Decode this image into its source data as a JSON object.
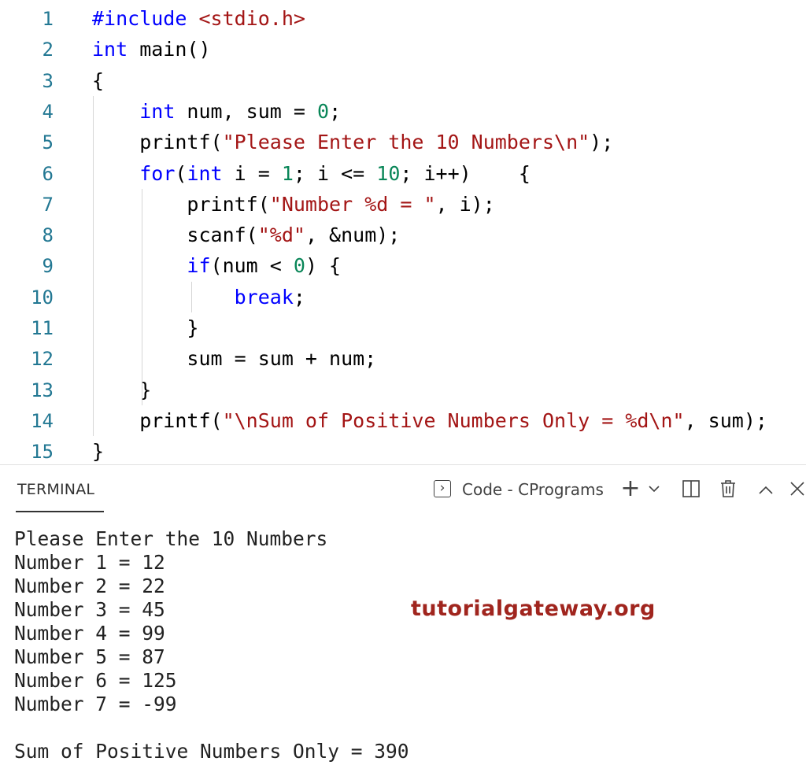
{
  "editor": {
    "lines": [
      {
        "n": "1",
        "t": [
          [
            "pp",
            "#include "
          ],
          [
            "inc",
            "<stdio.h>"
          ]
        ]
      },
      {
        "n": "2",
        "t": [
          [
            "kw",
            "int"
          ],
          [
            "",
            ""
          ],
          [
            "",
            " main()"
          ]
        ]
      },
      {
        "n": "3",
        "t": [
          [
            "",
            "{"
          ]
        ]
      },
      {
        "n": "4",
        "t": [
          [
            "",
            "    "
          ],
          [
            "kw",
            "int"
          ],
          [
            "",
            " num, sum = "
          ],
          [
            "num",
            "0"
          ],
          [
            "",
            ";"
          ]
        ]
      },
      {
        "n": "5",
        "t": [
          [
            "",
            "    printf("
          ],
          [
            "str",
            "\"Please Enter the 10 Numbers\\n\""
          ],
          [
            "",
            ");"
          ]
        ]
      },
      {
        "n": "6",
        "t": [
          [
            "",
            "    "
          ],
          [
            "kw",
            "for"
          ],
          [
            "",
            "("
          ],
          [
            "kw",
            "int"
          ],
          [
            "",
            " i = "
          ],
          [
            "num",
            "1"
          ],
          [
            "",
            "; i <= "
          ],
          [
            "num",
            "10"
          ],
          [
            "",
            "; i++)    {"
          ]
        ]
      },
      {
        "n": "7",
        "t": [
          [
            "",
            "        printf("
          ],
          [
            "str",
            "\"Number %d = \""
          ],
          [
            "",
            ", i);"
          ]
        ]
      },
      {
        "n": "8",
        "t": [
          [
            "",
            "        scanf("
          ],
          [
            "str",
            "\"%d\""
          ],
          [
            "",
            ", &num);"
          ]
        ]
      },
      {
        "n": "9",
        "t": [
          [
            "",
            "        "
          ],
          [
            "kw",
            "if"
          ],
          [
            "",
            "(num < "
          ],
          [
            "num",
            "0"
          ],
          [
            "",
            ") {"
          ]
        ]
      },
      {
        "n": "10",
        "t": [
          [
            "",
            "            "
          ],
          [
            "kw",
            "break"
          ],
          [
            "",
            ";"
          ]
        ]
      },
      {
        "n": "11",
        "t": [
          [
            "",
            "        }"
          ]
        ]
      },
      {
        "n": "12",
        "t": [
          [
            "",
            "        sum = sum + num;"
          ]
        ]
      },
      {
        "n": "13",
        "t": [
          [
            "",
            "    }"
          ]
        ]
      },
      {
        "n": "14",
        "t": [
          [
            "",
            "    printf("
          ],
          [
            "str",
            "\"\\nSum of Positive Numbers Only = %d\\n\""
          ],
          [
            "",
            ", sum);"
          ]
        ]
      },
      {
        "n": "15",
        "t": [
          [
            "",
            "}"
          ]
        ]
      }
    ]
  },
  "terminal": {
    "tab_label": "TERMINAL",
    "shell_icon": "terminal-icon",
    "shell_label": "Code - CPrograms",
    "actions": [
      {
        "name": "new-terminal-icon",
        "glyph": "+"
      },
      {
        "name": "dropdown-chevron-icon",
        "glyph": "⌵"
      },
      {
        "name": "split-terminal-icon",
        "glyph": "◫"
      },
      {
        "name": "trash-icon",
        "glyph": "🗑"
      },
      {
        "name": "maximize-chevron-icon",
        "glyph": "^"
      },
      {
        "name": "close-icon",
        "glyph": "✕"
      }
    ],
    "output": [
      "Please Enter the 10 Numbers",
      "Number 1 = 12",
      "Number 2 = 22",
      "Number 3 = 45",
      "Number 4 = 99",
      "Number 5 = 87",
      "Number 6 = 125",
      "Number 7 = -99",
      "",
      "Sum of Positive Numbers Only = 390"
    ]
  },
  "watermark": "tutorialgateway.org",
  "colors": {
    "keyword": "#0000ff",
    "string": "#a31515",
    "number": "#098658",
    "line_number": "#237893",
    "watermark": "#a0251e"
  }
}
